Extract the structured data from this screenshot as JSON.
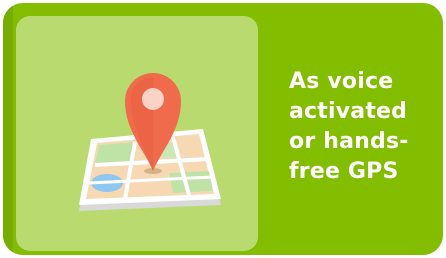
{
  "card": {
    "headline_lines": [
      "As voice",
      "activated",
      "or hands-",
      "free GPS"
    ]
  },
  "illustration": {
    "icon": "map-pin-icon"
  },
  "colors": {
    "card_background": "#82bd00",
    "inner_panel": "#b9da6f",
    "headline_text": "#ffffff",
    "pin": "#ef6b4c"
  }
}
